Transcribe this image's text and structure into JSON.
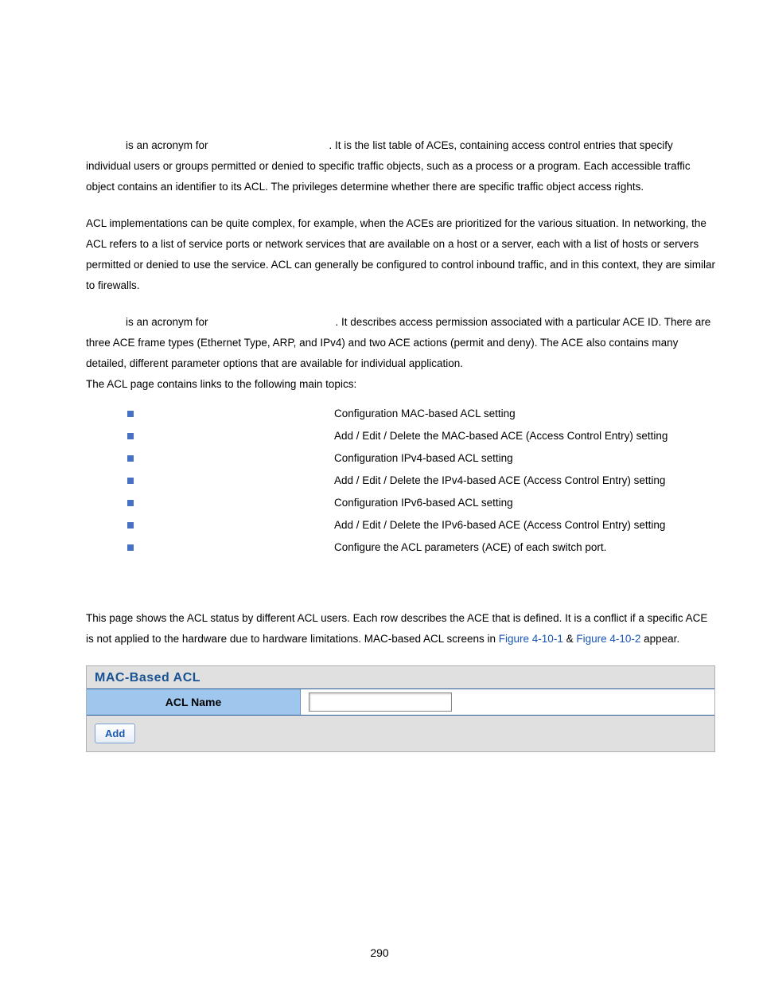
{
  "para1": "is an acronym for",
  "para1b": ". It is the list table of ACEs, containing access control entries that specify individual users or groups permitted or denied to specific traffic objects, such as a process or a program. Each accessible traffic object contains an identifier to its ACL. The privileges determine whether there are specific traffic object access rights.",
  "para2": "ACL implementations can be quite complex, for example, when the ACEs are prioritized for the various situation. In networking, the ACL refers to a list of service ports or network services that are available on a host or a server, each with a list of hosts or servers permitted or denied to use the service. ACL can generally be configured to control inbound traffic, and in this context, they are similar to firewalls.",
  "para3": "is an acronym for",
  "para3b": ". It describes access permission associated with a particular ACE ID. There are three ACE frame types (Ethernet Type, ARP, and IPv4) and two ACE actions (permit and deny). The ACE also contains many detailed, different parameter options that are available for individual application.",
  "para3c": "The ACL page contains links to the following main topics:",
  "topics": [
    "Configuration MAC-based ACL setting",
    "Add / Edit / Delete the MAC-based ACE (Access Control Entry) setting",
    "Configuration IPv4-based ACL setting",
    "Add / Edit / Delete the IPv4-based ACE (Access Control Entry) setting",
    "Configuration IPv6-based ACL setting",
    "Add / Edit / Delete the IPv6-based ACE (Access Control Entry) setting",
    "Configure the ACL parameters (ACE) of each switch port."
  ],
  "para4a": "This page shows the ACL status by different ACL users. Each row describes the ACE that is defined. It is a conflict if a specific ACE is not applied to the hardware due to hardware limitations. MAC-based ACL screens in ",
  "figref1": "Figure 4-10-1",
  "para4b": " & ",
  "figref2": "Figure 4-10-2",
  "para4c": " appear.",
  "mac": {
    "title": "MAC-Based ACL",
    "label": "ACL Name",
    "input_value": "",
    "add_label": "Add"
  },
  "page_number": "290"
}
